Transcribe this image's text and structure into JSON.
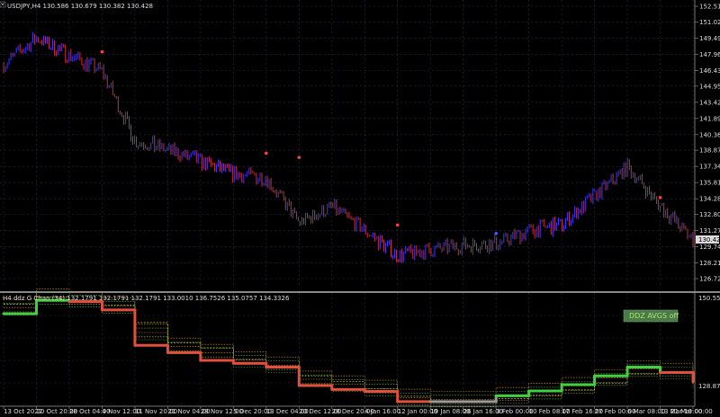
{
  "window": {
    "title": "USDJPY,H4"
  },
  "main_panel": {
    "header": "USDJPY,H4  130.586 130.679 130.382 130.428",
    "current_price_label": "130.428",
    "y_ticks": [
      "152.510",
      "151.025",
      "149.495",
      "147.965",
      "146.435",
      "144.950",
      "143.420",
      "141.890",
      "140.360",
      "138.875",
      "137.345",
      "135.815",
      "134.285",
      "132.800",
      "131.270",
      "129.740",
      "128.210",
      "126.725"
    ],
    "y_min": 126.725,
    "y_max": 152.51
  },
  "sub_panel": {
    "header": "H4 ddz G Chan (34) 132.1791 132.1791 132.1791 133.0010 136.7526 135.0757 134.3326",
    "top_label": "150.5531",
    "bottom_label": "128.8725",
    "badge_label": "DDZ AVGS off",
    "y_min": 128.8725,
    "y_max": 150.5531
  },
  "x_axis": {
    "labels": [
      "13 Oct 2022",
      "20 Oct 20:00",
      "28 Oct 04:00",
      "4 Nov 12:00",
      "11 Nov 20:00",
      "21 Nov 04:00",
      "28 Nov 12:00",
      "5 Dec 20:00",
      "13 Dec 04:00",
      "20 Dec 12:00",
      "28 Dec 20:00",
      "4 Jan 16:00",
      "12 Jan 00:00",
      "19 Jan 08:00",
      "26 Jan 16:00",
      "3 Feb 00:00",
      "10 Feb 08:00",
      "17 Feb 16:00",
      "27 Feb 00:00",
      "6 Mar 08:00",
      "13 Mar 16:00",
      "21 Mar 00:00"
    ]
  },
  "chart_data": {
    "type": "line",
    "title": "USDJPY,H4",
    "x": [
      "13 Oct 2022",
      "20 Oct 20:00",
      "28 Oct 04:00",
      "4 Nov 12:00",
      "11 Nov 20:00",
      "21 Nov 04:00",
      "28 Nov 12:00",
      "5 Dec 20:00",
      "13 Dec 04:00",
      "20 Dec 12:00",
      "28 Dec 20:00",
      "4 Jan 16:00",
      "12 Jan 00:00",
      "19 Jan 08:00",
      "26 Jan 16:00",
      "3 Feb 00:00",
      "10 Feb 08:00",
      "17 Feb 16:00",
      "27 Feb 00:00",
      "6 Mar 08:00",
      "13 Mar 16:00",
      "21 Mar 00:00"
    ],
    "series": [
      {
        "name": "USDJPY",
        "values": [
          147.0,
          149.5,
          147.9,
          146.4,
          139.8,
          138.9,
          137.8,
          136.6,
          136.3,
          132.0,
          133.5,
          131.3,
          128.9,
          129.4,
          129.9,
          130.0,
          131.3,
          131.8,
          134.5,
          137.3,
          133.6,
          130.4
        ]
      },
      {
        "name": "",
        "values": [
          149.0,
          150.5,
          149.7,
          148.8,
          145.2,
          141.0,
          140.0,
          137.6,
          136.2,
          134.2,
          133.0,
          131.6,
          130.0,
          129.1,
          129.1,
          129.5,
          130.2,
          131.3,
          132.7,
          134.6,
          134.7,
          133.2
        ]
      },
      {
        "name": "",
        "values": [
          147.0,
          149.8,
          149.5,
          147.8,
          140.5,
          139.0,
          137.4,
          136.8,
          136.0,
          132.2,
          131.4,
          131.0,
          128.9,
          128.9,
          128.9,
          130.1,
          131.1,
          132.4,
          134.2,
          136.0,
          134.9,
          133.0
        ]
      }
    ],
    "markers": [
      {
        "x": "4 Nov 12:00",
        "y": 148.2,
        "color": "#ff4040"
      },
      {
        "x": "13 Dec 04:00",
        "y": 138.6,
        "color": "#ff4040"
      },
      {
        "x": "20 Dec 12:00",
        "y": 138.2,
        "color": "#ff4040"
      },
      {
        "x": "12 Jan 00:00",
        "y": 131.8,
        "color": "#ff4040"
      },
      {
        "x": "3 Feb 00:00",
        "y": 131.0,
        "color": "#4060ff"
      },
      {
        "x": "13 Mar 16:00",
        "y": 134.4,
        "color": "#ff4040"
      }
    ],
    "ylim": [
      126.725,
      152.51
    ],
    "grid": true,
    "colors": {
      "up": "#3a3aff",
      "down": "#cc3030",
      "grid": "#2a2f40",
      "channel_red": "#e0503c",
      "channel_gray": "#9a9a9a",
      "channel_green": "#40d040",
      "dotted_orange": "#e0a020",
      "dotted_green": "#60c040",
      "dotted_olive": "#c0c040"
    }
  }
}
